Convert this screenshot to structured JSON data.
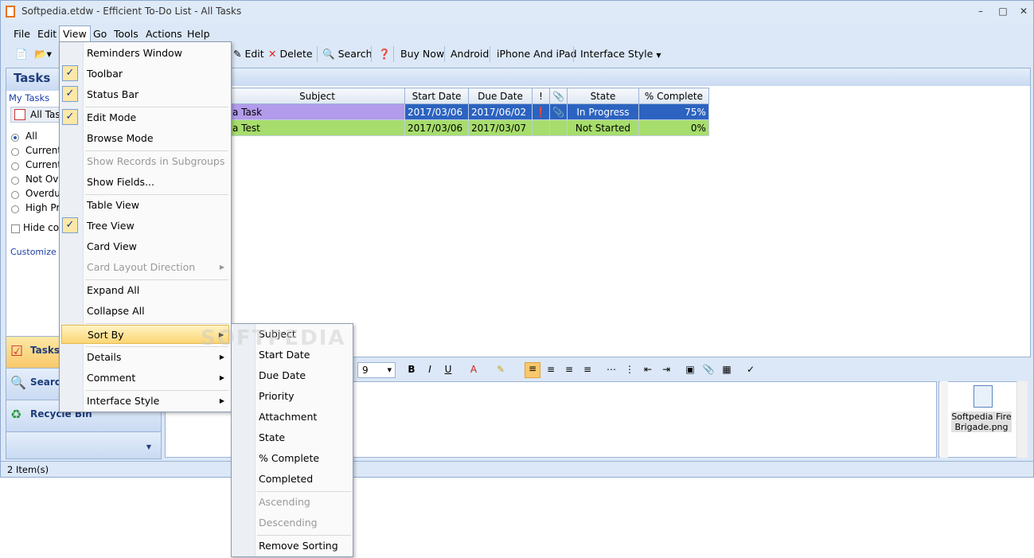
{
  "window": {
    "title": "Softpedia.etdw - Efficient To-Do List - All Tasks"
  },
  "menubar": [
    "File",
    "Edit",
    "View",
    "Go",
    "Tools",
    "Actions",
    "Help"
  ],
  "toolbar": {
    "edit": "Edit",
    "delete": "Delete",
    "search": "Search",
    "buy_now": "Buy Now",
    "android": "Android",
    "iphone": "iPhone And iPad",
    "interface_style": "Interface Style"
  },
  "left": {
    "heading": "Tasks",
    "my_tasks": "My Tasks",
    "all_tasks": "All Tasks",
    "filters": [
      "All",
      "Current",
      "Current",
      "Not Ove",
      "Overdue",
      "High Pri"
    ],
    "hide_completed": "Hide co",
    "customize": "Customize C"
  },
  "nav": {
    "tasks": "Tasks",
    "search": "Search",
    "recycle": "Recycle Bin"
  },
  "grid": {
    "headers": [
      "Subject",
      "Start Date",
      "Due Date",
      "!",
      "",
      "State",
      "% Complete"
    ],
    "rows": [
      {
        "subject": "a Task",
        "start": "2017/03/06",
        "due": "2017/06/02",
        "state": "In Progress",
        "pct": "75%"
      },
      {
        "subject": "a Test",
        "start": "2017/03/06",
        "due": "2017/03/07",
        "state": "Not Started",
        "pct": "0%"
      }
    ]
  },
  "editor": {
    "font_size": "9"
  },
  "attachment": {
    "name": "Softpedia Fire Brigade.png"
  },
  "status": "2 Item(s)",
  "view_menu": {
    "items": [
      "Reminders Window",
      "Toolbar",
      "Status Bar",
      "Edit Mode",
      "Browse Mode",
      "Show Records in Subgroups",
      "Show Fields...",
      "Table View",
      "Tree View",
      "Card View",
      "Card Layout Direction",
      "Expand All",
      "Collapse All",
      "Sort By",
      "Details",
      "Comment",
      "Interface Style"
    ]
  },
  "sort_menu": {
    "items": [
      "Subject",
      "Start Date",
      "Due Date",
      "Priority",
      "Attachment",
      "State",
      "% Complete",
      "Completed",
      "Ascending",
      "Descending",
      "Remove Sorting"
    ]
  },
  "watermark": "SOFTPEDIA"
}
